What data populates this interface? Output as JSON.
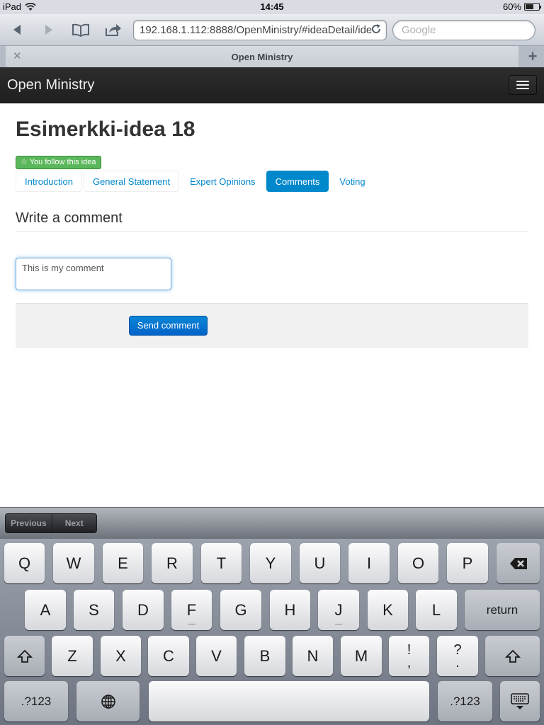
{
  "status_bar": {
    "device": "iPad",
    "time": "14:45",
    "battery": "60%",
    "battery_level": 0.6
  },
  "browser": {
    "url": "192.168.1.112:8888/OpenMinistry/#ideaDetail/ide",
    "search_placeholder": "Google",
    "tab_title": "Open Ministry",
    "icons": [
      "back-arrow-icon",
      "forward-arrow-icon",
      "bookmarks-book-icon",
      "share-icon",
      "reload-icon",
      "close-icon",
      "plus-icon"
    ]
  },
  "navbar": {
    "brand": "Open Ministry",
    "menu_icon": "hamburger-menu-icon"
  },
  "page": {
    "title": "Esimerkki-idea 18",
    "follow_badge": "☆ You follow this idea",
    "tabs": [
      "Introduction",
      "General Statement",
      "Expert Opinions",
      "Comments",
      "Voting"
    ],
    "active_tab": "Comments",
    "section_title": "Write a comment",
    "comment_value": "This is my comment",
    "send_button": "Send comment"
  },
  "keyboard": {
    "accessory": {
      "previous": "Previous",
      "next": "Next"
    },
    "row1": [
      "Q",
      "W",
      "E",
      "R",
      "T",
      "Y",
      "U",
      "I",
      "O",
      "P"
    ],
    "row2": [
      "A",
      "S",
      "D",
      "F",
      "G",
      "H",
      "J",
      "K",
      "L"
    ],
    "row3": [
      "Z",
      "X",
      "C",
      "V",
      "B",
      "N",
      "M"
    ],
    "punct1": [
      "!",
      ","
    ],
    "punct2": [
      "?",
      "."
    ],
    "return": "return",
    "numbers": ".?123",
    "icons": [
      "delete-backspace-icon",
      "shift-icon",
      "globe-icon",
      "hide-keyboard-icon"
    ]
  }
}
